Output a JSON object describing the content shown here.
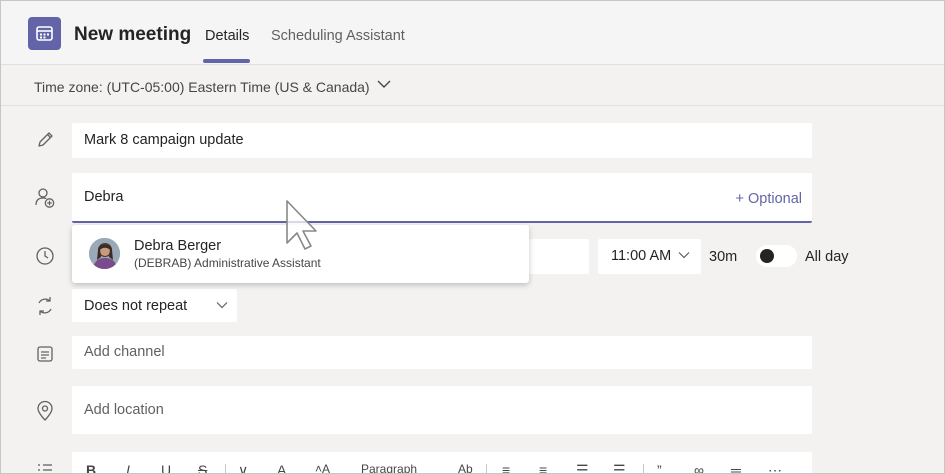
{
  "header": {
    "title": "New meeting",
    "tabs": [
      {
        "label": "Details",
        "active": true
      },
      {
        "label": "Scheduling Assistant",
        "active": false
      }
    ],
    "app_icon": "calendar-icon"
  },
  "timezone": {
    "label": "Time zone: (UTC-05:00) Eastern Time (US & Canada)"
  },
  "form": {
    "title_value": "Mark 8 campaign update",
    "attendees_value": "Debra",
    "optional_label": "+ Optional",
    "end_time": "11:00 AM",
    "duration": "30m",
    "all_day_label": "All day",
    "all_day_on": false,
    "repeat_value": "Does not repeat",
    "channel_placeholder": "Add channel",
    "location_placeholder": "Add location"
  },
  "suggestion": {
    "name": "Debra Berger",
    "detail": "(DEBRAB) Administrative Assistant"
  },
  "editor_toolbar": {
    "paragraph_label": "Paragraph"
  },
  "colors": {
    "accent": "#6264a7",
    "background": "#f3f2f1"
  }
}
